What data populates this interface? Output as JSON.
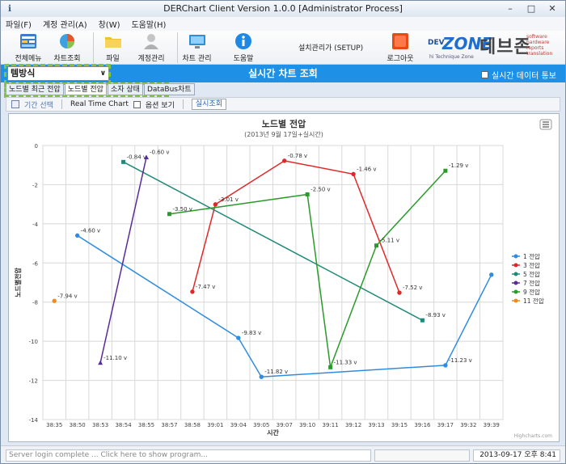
{
  "window": {
    "title": "DERChart Client Version 1.0.0 [Administrator Process]",
    "btn_minimize": "–",
    "btn_maximize": "□",
    "btn_close": "✕"
  },
  "menu": [
    "파일(F)",
    "계정 관리(A)",
    "창(W)",
    "도움말(H)"
  ],
  "toolbar": {
    "items": [
      {
        "label": "전체메뉴",
        "icon": "grid-menu-icon",
        "color": "#3d7cc9"
      },
      {
        "label": "차트조회",
        "icon": "pie-chart-icon",
        "color": "#e05a2a"
      },
      {
        "label": "파일",
        "icon": "folder-icon",
        "color": "#f1c230"
      },
      {
        "label": "계정관리",
        "icon": "user-icon",
        "color": "#b9b9b9"
      },
      {
        "label": "차트 관리",
        "icon": "monitor-icon",
        "color": "#2e8fd8"
      },
      {
        "label": "도움말",
        "icon": "info-icon",
        "color": "#1e88e5"
      },
      {
        "label": "로그아웃",
        "icon": "logout-icon",
        "color": "#e64a19"
      }
    ],
    "setup_label": "설치관리가 (SETUP)"
  },
  "logo": {
    "dev": "DEV",
    "zone": "ZONE",
    "korean": "데브존",
    "tagline": "software\nhardware\nreports\ntranslation",
    "sub": "hi Technique Zone"
  },
  "selector": {
    "value": "템방식",
    "arrow": "∨"
  },
  "page_title": "실시간 차트 조회",
  "realtime_notice": "실시간 데이터 통보",
  "tabs": [
    "노드별 최근 전압",
    "노드별 전압",
    "소자 상태",
    "DataBus차트"
  ],
  "filter": {
    "period": "기간 선택",
    "realtime": "Real Time Chart",
    "show_options": "옵션 보기",
    "search_button": "실시조회"
  },
  "status": {
    "message": "Server login complete ... Click here to show program...",
    "datetime": "2013-09-17 오후 8:41"
  },
  "chart_data": {
    "type": "line",
    "title": "노드별 전압",
    "subtitle": "(2013년 9월 17일+실시간)",
    "xlabel": "시간",
    "ylabel": "노드별전압",
    "categories": [
      "38:35",
      "38:50",
      "38:53",
      "38:54",
      "38:55",
      "38:57",
      "38:58",
      "39:01",
      "39:04",
      "39:05",
      "39:07",
      "39:10",
      "39:11",
      "39:12",
      "39:13",
      "39:15",
      "39:16",
      "39:17",
      "39:32",
      "39:39"
    ],
    "ylim": [
      -14,
      0
    ],
    "yticks": [
      0,
      -2,
      -4,
      -6,
      -8,
      -10,
      -12,
      -14
    ],
    "grid": true,
    "legend_position": "right",
    "credit": "Highcharts.com",
    "series": [
      {
        "name": "1 전압",
        "color": "#2f8ce0",
        "points": [
          [
            1,
            -4.6,
            "-4.60 v"
          ],
          [
            8,
            -9.83,
            "-9.83 v"
          ],
          [
            9,
            -11.82,
            "-11.82 v"
          ],
          [
            17,
            -11.23,
            "-11.23 v"
          ],
          [
            19,
            -6.6,
            ""
          ]
        ]
      },
      {
        "name": "3 전압",
        "color": "#e02828",
        "points": [
          [
            6,
            -7.47,
            "-7.47 v"
          ],
          [
            7,
            -3.01,
            "-3.01 v"
          ],
          [
            10,
            -0.78,
            "-0.78 v"
          ],
          [
            13,
            -1.46,
            "-1.46 v"
          ],
          [
            15,
            -7.52,
            "-7.52 v"
          ]
        ]
      },
      {
        "name": "5 전압",
        "color": "#1e8a78",
        "points": [
          [
            3,
            -0.84,
            "-0.84 v"
          ],
          [
            16,
            -8.93,
            "-8.93 v"
          ]
        ]
      },
      {
        "name": "7 전압",
        "color": "#5a2a9a",
        "points": [
          [
            2,
            -11.1,
            "-11.10 v"
          ],
          [
            4,
            -0.6,
            "-0.60 v"
          ]
        ]
      },
      {
        "name": "9 전압",
        "color": "#2a9a2a",
        "points": [
          [
            5,
            -3.5,
            "-3.50 v"
          ],
          [
            11,
            -2.5,
            "-2.50 v"
          ],
          [
            12,
            -11.33,
            "-11.33 v"
          ],
          [
            14,
            -5.11,
            "-5.11 v"
          ],
          [
            17,
            -1.29,
            "-1.29 v"
          ]
        ]
      },
      {
        "name": "11 전압",
        "color": "#f08a1a",
        "points": [
          [
            0,
            -7.94,
            "-7.94 v"
          ]
        ]
      }
    ]
  }
}
